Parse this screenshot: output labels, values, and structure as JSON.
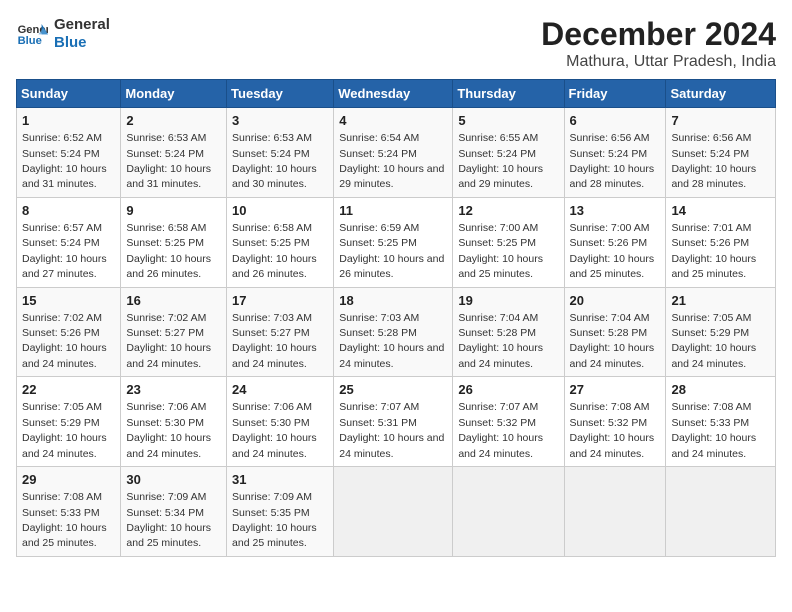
{
  "logo": {
    "line1": "General",
    "line2": "Blue"
  },
  "title": "December 2024",
  "subtitle": "Mathura, Uttar Pradesh, India",
  "days_of_week": [
    "Sunday",
    "Monday",
    "Tuesday",
    "Wednesday",
    "Thursday",
    "Friday",
    "Saturday"
  ],
  "weeks": [
    [
      {
        "day": 1,
        "sunrise": "6:52 AM",
        "sunset": "5:24 PM",
        "daylight": "10 hours and 31 minutes."
      },
      {
        "day": 2,
        "sunrise": "6:53 AM",
        "sunset": "5:24 PM",
        "daylight": "10 hours and 31 minutes."
      },
      {
        "day": 3,
        "sunrise": "6:53 AM",
        "sunset": "5:24 PM",
        "daylight": "10 hours and 30 minutes."
      },
      {
        "day": 4,
        "sunrise": "6:54 AM",
        "sunset": "5:24 PM",
        "daylight": "10 hours and 29 minutes."
      },
      {
        "day": 5,
        "sunrise": "6:55 AM",
        "sunset": "5:24 PM",
        "daylight": "10 hours and 29 minutes."
      },
      {
        "day": 6,
        "sunrise": "6:56 AM",
        "sunset": "5:24 PM",
        "daylight": "10 hours and 28 minutes."
      },
      {
        "day": 7,
        "sunrise": "6:56 AM",
        "sunset": "5:24 PM",
        "daylight": "10 hours and 28 minutes."
      }
    ],
    [
      {
        "day": 8,
        "sunrise": "6:57 AM",
        "sunset": "5:24 PM",
        "daylight": "10 hours and 27 minutes."
      },
      {
        "day": 9,
        "sunrise": "6:58 AM",
        "sunset": "5:25 PM",
        "daylight": "10 hours and 26 minutes."
      },
      {
        "day": 10,
        "sunrise": "6:58 AM",
        "sunset": "5:25 PM",
        "daylight": "10 hours and 26 minutes."
      },
      {
        "day": 11,
        "sunrise": "6:59 AM",
        "sunset": "5:25 PM",
        "daylight": "10 hours and 26 minutes."
      },
      {
        "day": 12,
        "sunrise": "7:00 AM",
        "sunset": "5:25 PM",
        "daylight": "10 hours and 25 minutes."
      },
      {
        "day": 13,
        "sunrise": "7:00 AM",
        "sunset": "5:26 PM",
        "daylight": "10 hours and 25 minutes."
      },
      {
        "day": 14,
        "sunrise": "7:01 AM",
        "sunset": "5:26 PM",
        "daylight": "10 hours and 25 minutes."
      }
    ],
    [
      {
        "day": 15,
        "sunrise": "7:02 AM",
        "sunset": "5:26 PM",
        "daylight": "10 hours and 24 minutes."
      },
      {
        "day": 16,
        "sunrise": "7:02 AM",
        "sunset": "5:27 PM",
        "daylight": "10 hours and 24 minutes."
      },
      {
        "day": 17,
        "sunrise": "7:03 AM",
        "sunset": "5:27 PM",
        "daylight": "10 hours and 24 minutes."
      },
      {
        "day": 18,
        "sunrise": "7:03 AM",
        "sunset": "5:28 PM",
        "daylight": "10 hours and 24 minutes."
      },
      {
        "day": 19,
        "sunrise": "7:04 AM",
        "sunset": "5:28 PM",
        "daylight": "10 hours and 24 minutes."
      },
      {
        "day": 20,
        "sunrise": "7:04 AM",
        "sunset": "5:28 PM",
        "daylight": "10 hours and 24 minutes."
      },
      {
        "day": 21,
        "sunrise": "7:05 AM",
        "sunset": "5:29 PM",
        "daylight": "10 hours and 24 minutes."
      }
    ],
    [
      {
        "day": 22,
        "sunrise": "7:05 AM",
        "sunset": "5:29 PM",
        "daylight": "10 hours and 24 minutes."
      },
      {
        "day": 23,
        "sunrise": "7:06 AM",
        "sunset": "5:30 PM",
        "daylight": "10 hours and 24 minutes."
      },
      {
        "day": 24,
        "sunrise": "7:06 AM",
        "sunset": "5:30 PM",
        "daylight": "10 hours and 24 minutes."
      },
      {
        "day": 25,
        "sunrise": "7:07 AM",
        "sunset": "5:31 PM",
        "daylight": "10 hours and 24 minutes."
      },
      {
        "day": 26,
        "sunrise": "7:07 AM",
        "sunset": "5:32 PM",
        "daylight": "10 hours and 24 minutes."
      },
      {
        "day": 27,
        "sunrise": "7:08 AM",
        "sunset": "5:32 PM",
        "daylight": "10 hours and 24 minutes."
      },
      {
        "day": 28,
        "sunrise": "7:08 AM",
        "sunset": "5:33 PM",
        "daylight": "10 hours and 24 minutes."
      }
    ],
    [
      {
        "day": 29,
        "sunrise": "7:08 AM",
        "sunset": "5:33 PM",
        "daylight": "10 hours and 25 minutes."
      },
      {
        "day": 30,
        "sunrise": "7:09 AM",
        "sunset": "5:34 PM",
        "daylight": "10 hours and 25 minutes."
      },
      {
        "day": 31,
        "sunrise": "7:09 AM",
        "sunset": "5:35 PM",
        "daylight": "10 hours and 25 minutes."
      },
      null,
      null,
      null,
      null
    ]
  ]
}
